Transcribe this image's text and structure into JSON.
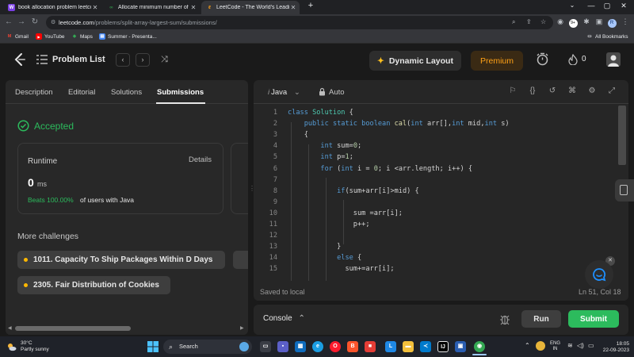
{
  "browser": {
    "tabs": [
      {
        "title": "book allocation problem leetcode",
        "favicon": "W",
        "active": false
      },
      {
        "title": "Allocate minimum number of pa",
        "favicon": "GfG",
        "active": false
      },
      {
        "title": "LeetCode - The World's Leading",
        "favicon": "LC",
        "active": true
      }
    ],
    "url_host": "leetcode.com",
    "url_path": "/problems/split-array-largest-sum/submissions/",
    "bookmarks": [
      "Gmail",
      "YouTube",
      "Maps",
      "Summer - Presenta..."
    ],
    "all_bookmarks": "All Bookmarks"
  },
  "nav": {
    "problem_list": "Problem List",
    "dynamic_layout": "Dynamic Layout",
    "premium": "Premium",
    "streak_count": "0"
  },
  "left": {
    "tabs": [
      "Description",
      "Editorial",
      "Solutions",
      "Submissions"
    ],
    "active_tab": "Submissions",
    "status": "Accepted",
    "runtime_label": "Runtime",
    "details": "Details",
    "runtime_value": "0",
    "runtime_unit": "ms",
    "beats": "Beats 100.00%",
    "beats_rest": "of users with Java",
    "more_challenges": "More challenges",
    "challenges": [
      "1011. Capacity To Ship Packages Within D Days",
      "2305. Fair Distribution of Cookies"
    ]
  },
  "editor": {
    "language": "Java",
    "mode": "Auto",
    "saved": "Saved to local",
    "cursor": "Ln 51, Col 18",
    "line_numbers": [
      "1",
      "2",
      "3",
      "4",
      "5",
      "6",
      "7",
      "8",
      "9",
      "10",
      "11",
      "12",
      "13",
      "14",
      "15"
    ],
    "code_lines": [
      "class Solution {",
      "    public static boolean cal(int arr[],int mid,int s)",
      "    {",
      "        int sum=0;",
      "        int p=1;",
      "        for (int i = 0; i <arr.length; i++) {",
      "",
      "            if(sum+arr[i]>mid) {",
      "",
      "                sum =arr[i];",
      "                p++;",
      "",
      "            }",
      "            else {",
      "              sum+=arr[i];"
    ]
  },
  "console": {
    "label": "Console",
    "run": "Run",
    "submit": "Submit"
  },
  "taskbar": {
    "temperature": "30°C",
    "weather": "Partly sunny",
    "search": "Search",
    "lang_top": "ENG",
    "lang_bottom": "IN",
    "time": "18:05",
    "date": "22-09-2023"
  },
  "colors": {
    "accent_green": "#2cbb5d",
    "premium_orange": "#ffa116",
    "chip_dot": "#ffb800"
  }
}
